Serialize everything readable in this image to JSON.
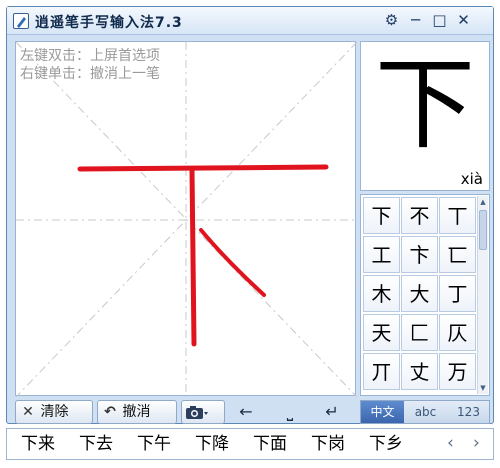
{
  "window": {
    "title": "逍遥笔手写输入法7.3",
    "title_icon": "pen-app-icon",
    "buttons": [
      {
        "name": "settings-gear-icon",
        "glyph": "⚙"
      },
      {
        "name": "minimize-icon",
        "glyph": "─"
      },
      {
        "name": "maximize-icon",
        "glyph": "□"
      },
      {
        "name": "close-icon",
        "glyph": "✕"
      }
    ]
  },
  "canvas": {
    "hint_line1": "左键双击：上屏首选项",
    "hint_line2": "右键单击：撤消上一笔",
    "stroke_color": "#e0141e"
  },
  "preview": {
    "char": "下",
    "pinyin": "xià"
  },
  "candidates": [
    "下",
    "不",
    "丅",
    "工",
    "卞",
    "匸",
    "木",
    "大",
    "丁",
    "天",
    "匚",
    "仄",
    "丌",
    "丈",
    "万"
  ],
  "toolbar": {
    "clear_label": "清除",
    "undo_label": "撤消",
    "clear_icon": "✕",
    "undo_icon": "↶",
    "camera_icon": "camera-icon",
    "back_arrow": "←",
    "space_glyph": "⎵",
    "enter_glyph": "↵"
  },
  "lang": {
    "tabs": [
      "中文",
      "abc",
      "123"
    ],
    "active": 0,
    "active_color": "#3b66ad"
  },
  "phrases": [
    "下来",
    "下去",
    "下午",
    "下降",
    "下面",
    "下岗",
    "下乡"
  ],
  "nav": {
    "prev": "‹",
    "next": "›"
  }
}
